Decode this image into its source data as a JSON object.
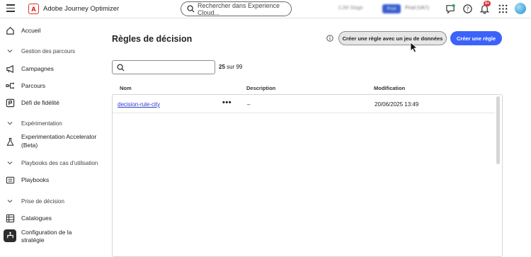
{
  "topbar": {
    "app_name": "Adobe Journey Optimizer",
    "search_placeholder": "Rechercher dans Experience Cloud...",
    "env_label_1": "CJM Stage",
    "env_label_2": "Prod",
    "env_label_3": "Prod (VA7)",
    "notif_badge": "9+"
  },
  "sidebar": {
    "home": "Accueil",
    "section_journeys": "Gestion des parcours",
    "campaigns": "Campagnes",
    "journeys": "Parcours",
    "loyalty": "Défi de fidélité",
    "section_experimentation": "Expérimentation",
    "exp_accel_line1": "Experimentation Accelerator",
    "exp_accel_line2": "(Beta)",
    "section_playbooks": "Playbooks des cas d'utilisation",
    "playbooks": "Playbooks",
    "section_decision": "Prise de décision",
    "catalogs": "Catalogues",
    "strategy_line1": "Configuration de la",
    "strategy_line2": "stratégie"
  },
  "main": {
    "title": "Règles de décision",
    "btn_dataset_rule": "Créer une règle avec un jeu de données",
    "btn_create_rule": "Créer une règle",
    "count_number": "25",
    "count_suffix": "sur 99",
    "columns": {
      "name": "Nom",
      "description": "Description",
      "modified": "Modification"
    },
    "rows": [
      {
        "name": "decision-rule-city",
        "more": "•••",
        "description": "–",
        "modified": "20/06/2025 13:49"
      }
    ]
  }
}
